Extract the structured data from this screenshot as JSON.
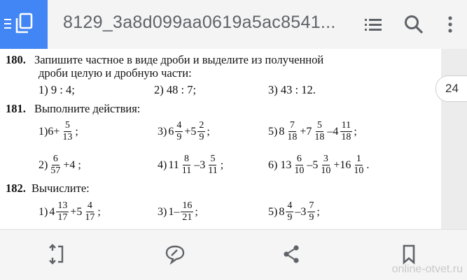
{
  "toolbar": {
    "title": "8129_3a8d099aa0619a5ac8541...",
    "page_number": "24"
  },
  "exercises": {
    "e180": {
      "number": "180.",
      "text_line1": "Запишите частное в виде дроби и выделите из полученной",
      "text_line2": "дроби целую и дробную части:",
      "a": "1) 9 : 4;",
      "b": "2) 48 : 7;",
      "c": "3) 43 : 12."
    },
    "e181": {
      "number": "181.",
      "text": "Выполните действия:",
      "i1": {
        "label": "1)",
        "p1": "6+",
        "f1n": "5",
        "f1d": "13",
        "end": ";"
      },
      "i3": {
        "label": "3)",
        "w1": "6",
        "f1n": "4",
        "f1d": "9",
        "op": "+5",
        "f2n": "2",
        "f2d": "9",
        "end": ";"
      },
      "i5": {
        "label": "5)",
        "w1": "8",
        "f1n": "7",
        "f1d": "18",
        "op1": "+7",
        "f2n": "5",
        "f2d": "18",
        "op2": "–4",
        "f3n": "11",
        "f3d": "18",
        "end": ";"
      },
      "i2": {
        "label": "2)",
        "f1n": "6",
        "f1d": "57",
        "tail": "+4 ;"
      },
      "i4": {
        "label": "4)",
        "w1": "11",
        "f1n": "8",
        "f1d": "11",
        "op": "–3",
        "f2n": "5",
        "f2d": "11",
        "end": ";"
      },
      "i6": {
        "label": "6)",
        "w1": "13",
        "f1n": "6",
        "f1d": "10",
        "op1": "–5",
        "f2n": "3",
        "f2d": "10",
        "op2": "+16",
        "f3n": "1",
        "f3d": "10",
        "end": "."
      }
    },
    "e182": {
      "number": "182.",
      "text": "Вычислите:",
      "i1": {
        "label": "1)",
        "w1": "4",
        "f1n": "13",
        "f1d": "17",
        "op": "+5",
        "f2n": "4",
        "f2d": "17",
        "end": ";"
      },
      "i3": {
        "label": "3)",
        "p1": "1–",
        "f1n": "16",
        "f1d": "21",
        "end": ";"
      },
      "i5": {
        "label": "5)",
        "w1": "8",
        "f1n": "4",
        "f1d": "9",
        "op": "–3",
        "f2n": "7",
        "f2d": "9",
        "end": ";"
      }
    }
  },
  "watermark": "online-otvet.ru",
  "icons": {
    "app": "document-icon",
    "list": "list-icon",
    "search": "search-icon",
    "more": "more-vert-icon",
    "expand": "expand-icon",
    "comment": "comment-edit-icon",
    "share": "share-icon",
    "bookmark": "bookmark-icon"
  },
  "colors": {
    "accent": "#4285f4",
    "toolbar_icon": "#5f6368"
  }
}
